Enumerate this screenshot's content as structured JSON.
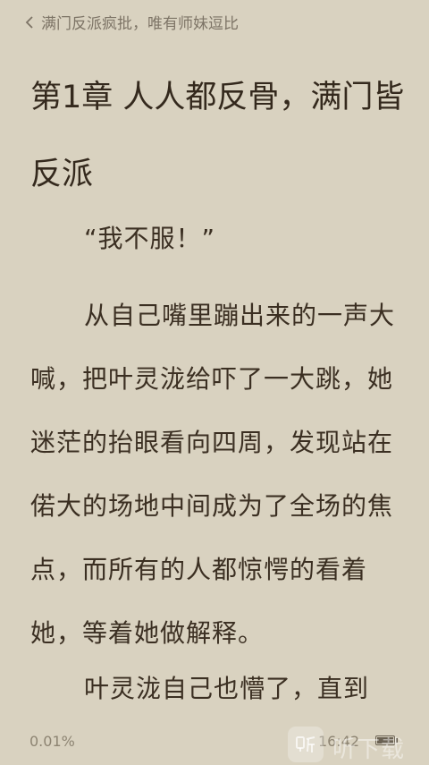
{
  "header": {
    "back_icon": "chevron-left-icon",
    "book_title": "满门反派疯批，唯有师妹逗比"
  },
  "chapter": {
    "title": "第1章 人人都反骨，满门皆反派"
  },
  "paragraphs": [
    "“我不服！”",
    "从自己嘴里蹦出来的一声大喊，把叶灵泷给吓了一大跳，她迷茫的抬眼看向四周，发现站在偌大的场地中间成为了全场的焦点，而所有的人都惊愕的看着她，等着她做解释。",
    "叶灵泷自己也懵了，直到"
  ],
  "footer": {
    "progress": "0.01%",
    "time": "16:42",
    "battery_icon": "battery-icon"
  },
  "watermark": {
    "logo_icon": "ting-logo-icon",
    "text": "听下载"
  },
  "colors": {
    "background": "#d9d2c0",
    "text": "#3b2f22",
    "muted": "#8d8472"
  }
}
